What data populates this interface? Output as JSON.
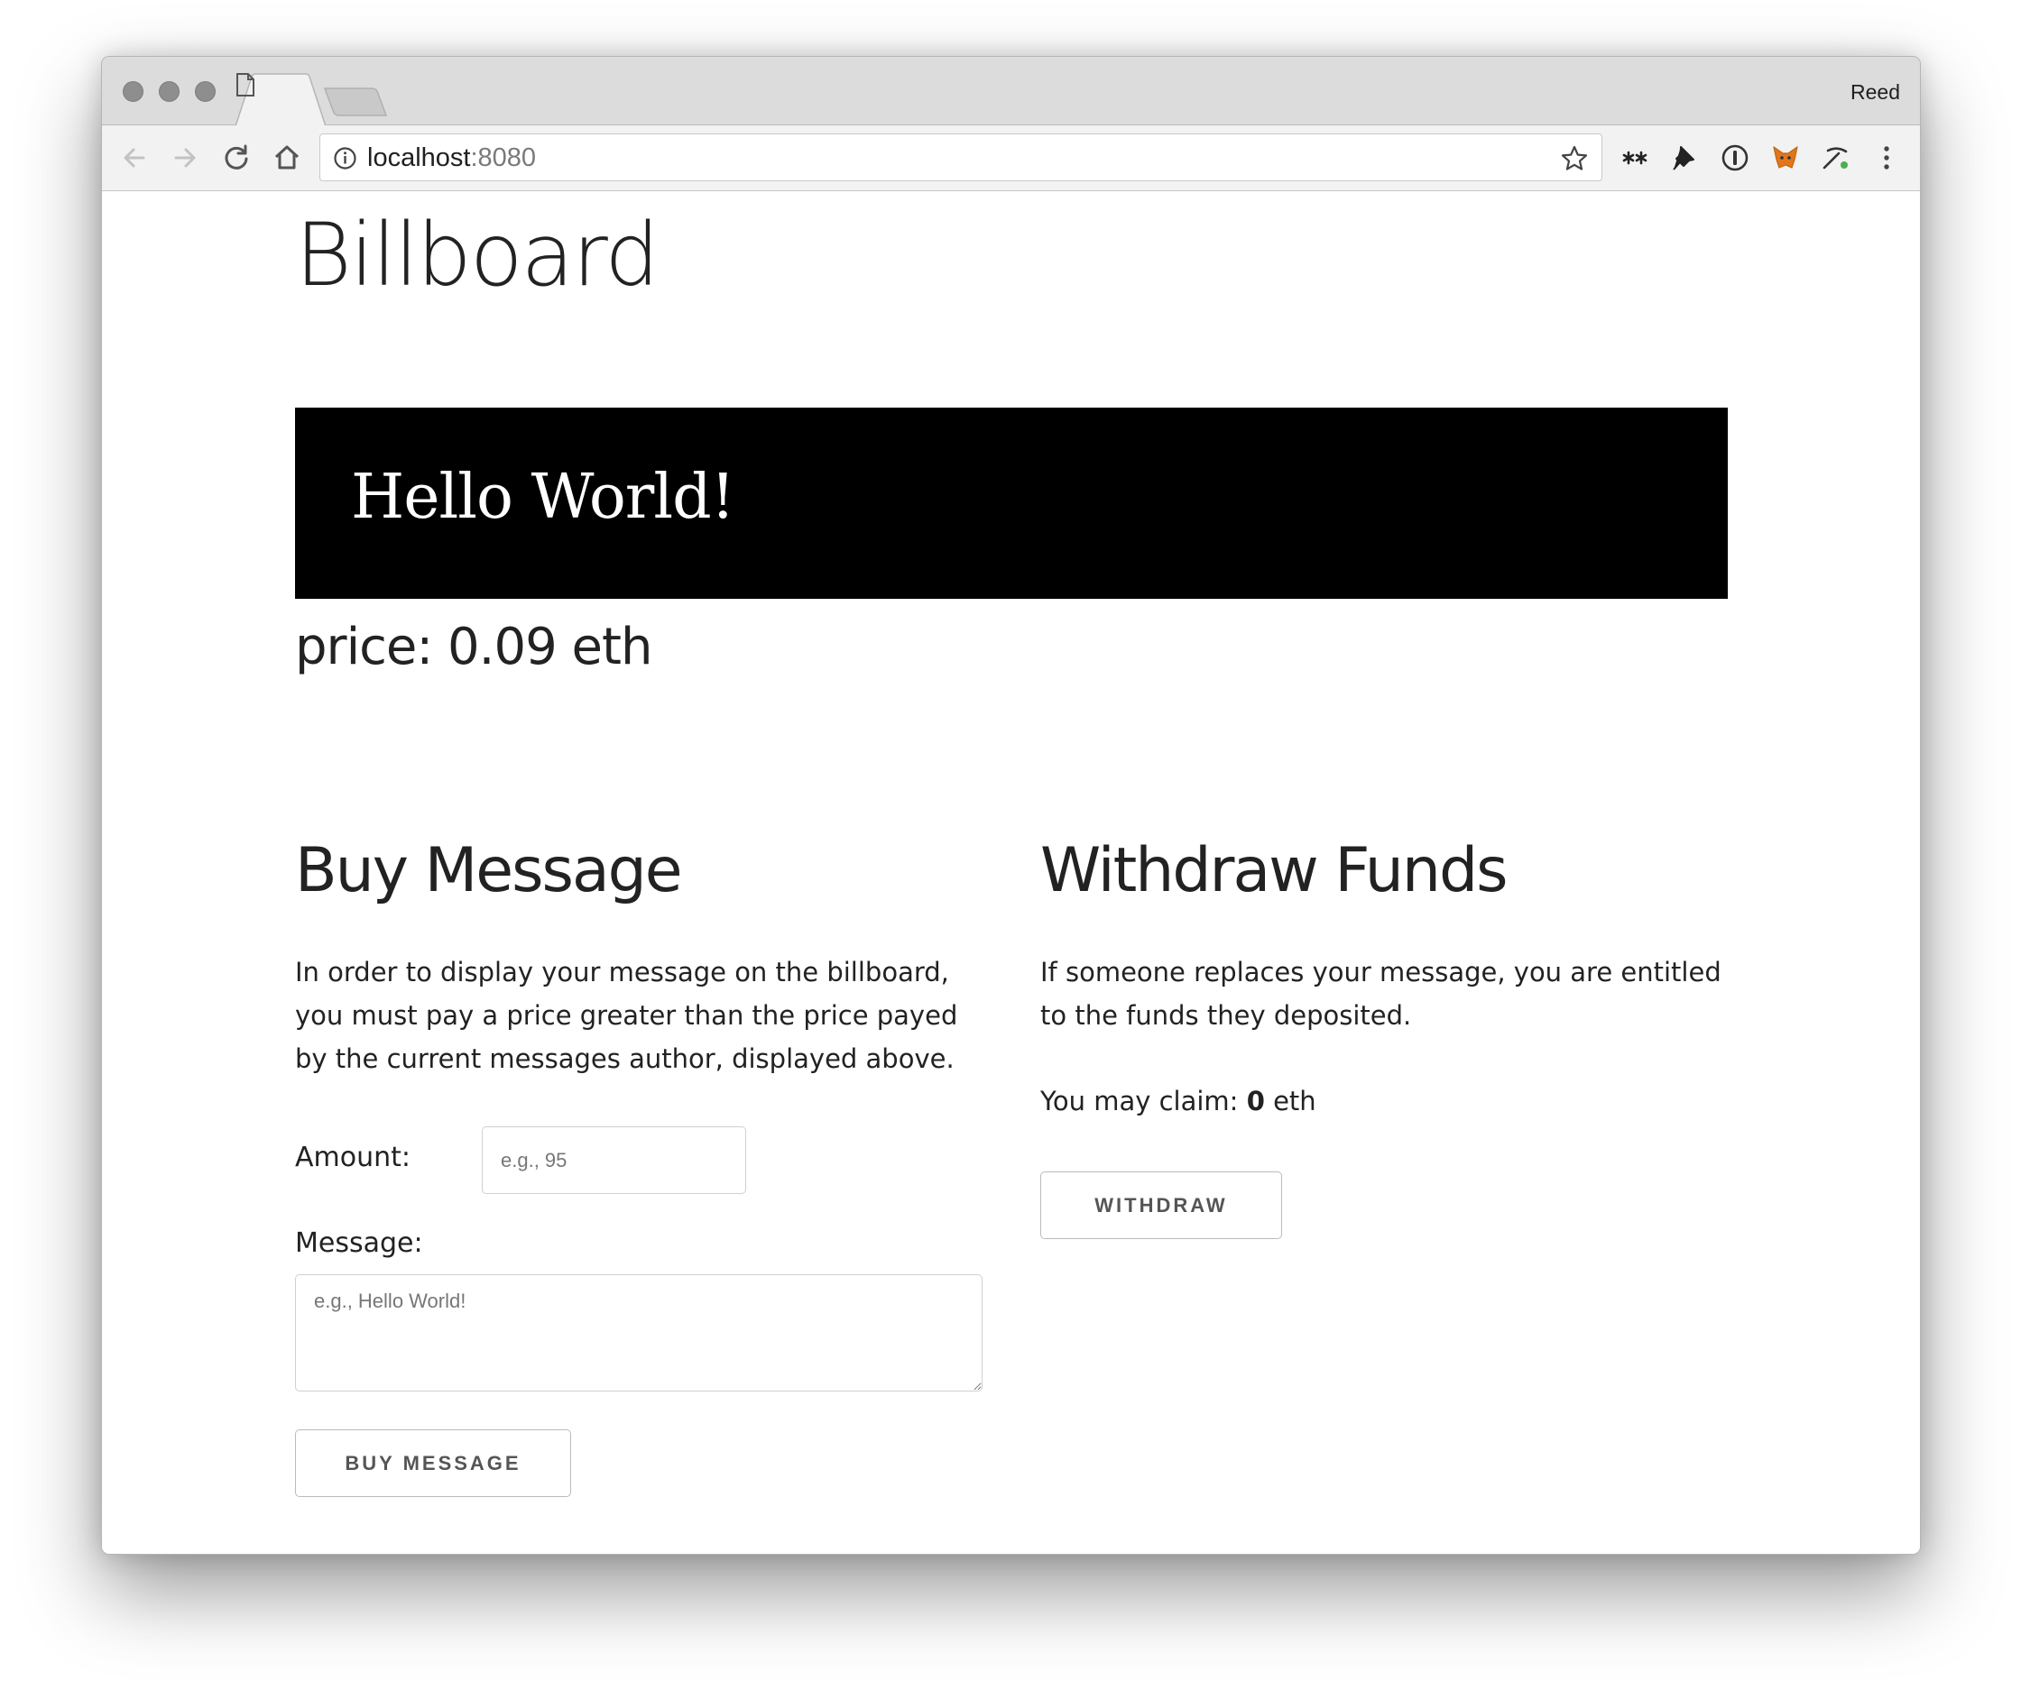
{
  "browser": {
    "profile_name": "Reed",
    "url_host": "localhost",
    "url_port": ":8080",
    "toolbar_icons": [
      "back-icon",
      "forward-icon",
      "reload-icon",
      "home-icon",
      "info-icon",
      "star-icon"
    ],
    "extension_icons": [
      "double-asterisk-icon",
      "pushpin-icon",
      "password-manager-icon",
      "metamask-fox-icon",
      "pickaxe-icon",
      "menu-dots-icon"
    ]
  },
  "page": {
    "title": "Billboard",
    "billboard_message": "Hello World!",
    "price_label": "price: 0.09 eth"
  },
  "buy": {
    "heading": "Buy Message",
    "description": "In order to display your message on the billboard, you must pay a price greater than the price payed by the current messages author, displayed above.",
    "amount_label": "Amount:",
    "amount_placeholder": "e.g., 95",
    "message_label": "Message:",
    "message_placeholder": "e.g., Hello World!",
    "button_label": "Buy Message"
  },
  "withdraw": {
    "heading": "Withdraw Funds",
    "description": "If someone replaces your message, you are entitled to the funds they deposited.",
    "claim_prefix": "You may claim: ",
    "claim_amount": "0",
    "claim_suffix": " eth",
    "button_label": "Withdraw"
  },
  "colors": {
    "billboard_background": "#000000",
    "billboard_text": "#ffffff",
    "heading_text": "#222222",
    "metamask_orange": "#e2761b",
    "pickaxe_green": "#4caf50"
  }
}
